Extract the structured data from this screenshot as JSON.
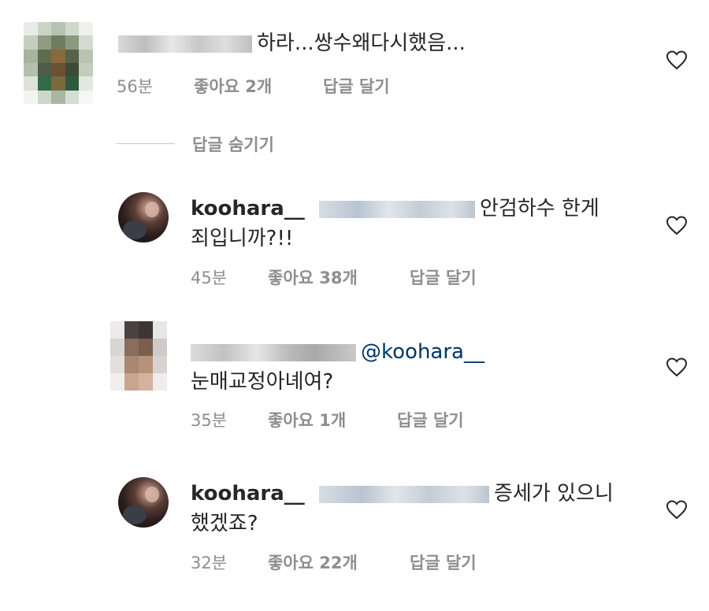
{
  "comments": [
    {
      "username": "",
      "text": "하라...쌍수왜다시했음...",
      "time": "56분",
      "likes": "좋아요 2개",
      "reply": "답글 달기"
    },
    {
      "username": "koohara__",
      "text_line1": "안검하수 한게",
      "text_line2": "죄입니까?!!",
      "time": "45분",
      "likes": "좋아요 38개",
      "reply": "답글 달기"
    },
    {
      "username": "",
      "mention": "@koohara__",
      "text_line2": "눈매교정아녜여?",
      "time": "35분",
      "likes": "좋아요 1개",
      "reply": "답글 달기"
    },
    {
      "username": "koohara__",
      "text_line1": "증세가 있으니",
      "text_line2": "했겠죠?",
      "time": "32분",
      "likes": "좋아요 22개",
      "reply": "답글 달기"
    }
  ],
  "hide_replies": "답글 숨기기",
  "icons": {
    "like": "heart-outline-icon"
  },
  "colors": {
    "text": "#262626",
    "meta": "#8e8e8e",
    "mention": "#003569"
  }
}
